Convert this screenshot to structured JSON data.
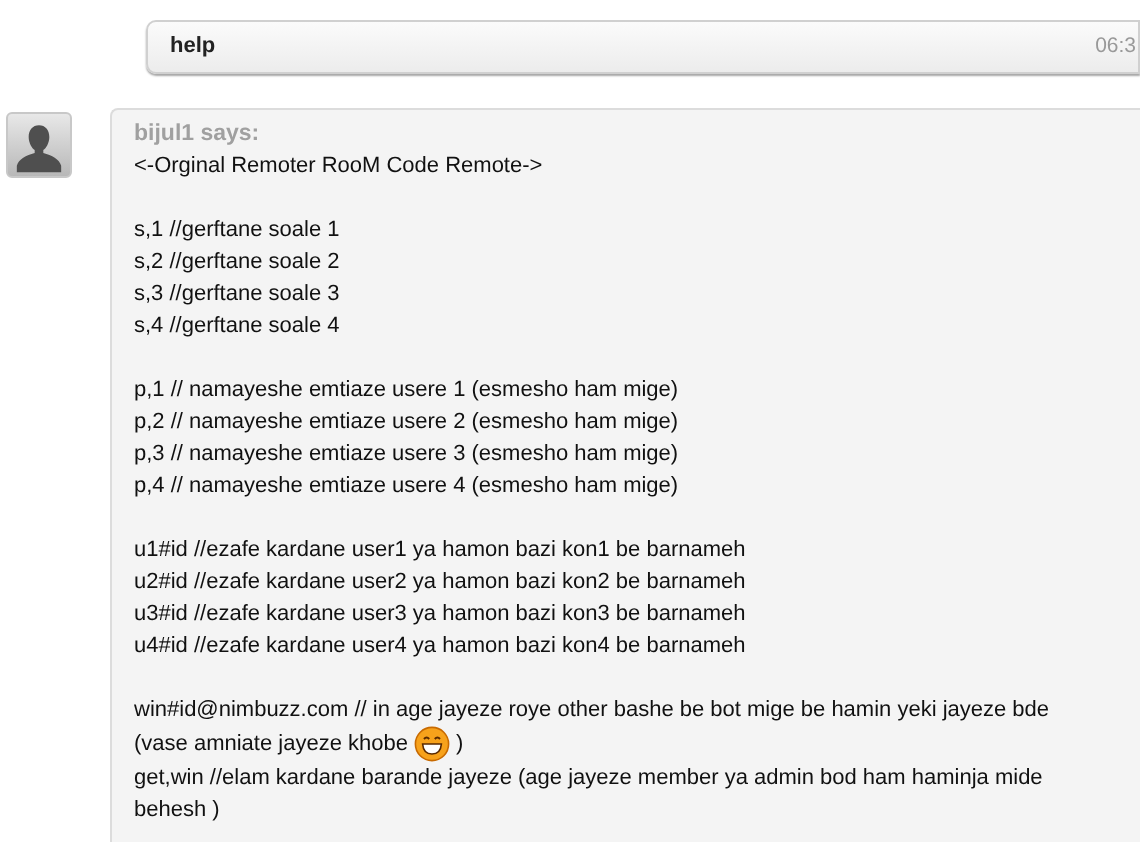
{
  "sent_message": {
    "text": "help",
    "time": "06:3"
  },
  "message": {
    "sender": "bijul1 says:",
    "groups": [
      [
        [
          {
            "kind": "text",
            "text": "<-Orginal Remoter RooM Code Remote->"
          }
        ]
      ],
      [
        [
          {
            "kind": "text",
            "text": "s,1 //gerftane soale 1"
          }
        ],
        [
          {
            "kind": "text",
            "text": "s,2 //gerftane soale 2"
          }
        ],
        [
          {
            "kind": "text",
            "text": "s,3 //gerftane soale 3"
          }
        ],
        [
          {
            "kind": "text",
            "text": "s,4 //gerftane soale 4"
          }
        ]
      ],
      [
        [
          {
            "kind": "text",
            "text": "p,1 // namayeshe emtiaze usere 1 (esmesho ham mige)"
          }
        ],
        [
          {
            "kind": "text",
            "text": "p,2 // namayeshe emtiaze usere 2 (esmesho ham mige)"
          }
        ],
        [
          {
            "kind": "text",
            "text": "p,3 // namayeshe emtiaze usere 3 (esmesho ham mige)"
          }
        ],
        [
          {
            "kind": "text",
            "text": "p,4 // namayeshe emtiaze usere 4 (esmesho ham mige)"
          }
        ]
      ],
      [
        [
          {
            "kind": "text",
            "text": "u1#id //ezafe kardane user1 ya hamon bazi kon1 be barnameh"
          }
        ],
        [
          {
            "kind": "text",
            "text": "u2#id //ezafe kardane user2 ya hamon bazi kon2 be barnameh"
          }
        ],
        [
          {
            "kind": "text",
            "text": "u3#id //ezafe kardane user3 ya hamon bazi kon3 be barnameh"
          }
        ],
        [
          {
            "kind": "text",
            "text": "u4#id //ezafe kardane user4 ya hamon bazi kon4 be barnameh"
          }
        ]
      ],
      [
        [
          {
            "kind": "text",
            "text": "win#id@nimbuzz.com // in age jayeze roye other bashe be bot mige be hamin yeki jayeze bde"
          }
        ],
        [
          {
            "kind": "text",
            "text": "(vase amniate jayeze khobe"
          },
          {
            "kind": "emoji"
          },
          {
            "kind": "text",
            "text": ")"
          }
        ],
        [
          {
            "kind": "text",
            "text": "get,win //elam kardane barande jayeze (age jayeze member ya admin bod ham haminja mide behesh )"
          }
        ]
      ]
    ]
  }
}
